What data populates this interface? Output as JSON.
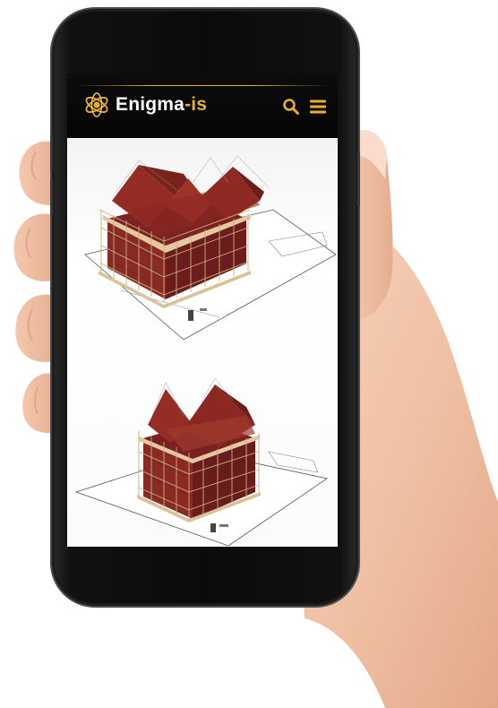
{
  "app": {
    "brand_prefix": "Enigma",
    "brand_suffix": "-is"
  },
  "header": {
    "search_icon": "search-icon",
    "menu_icon": "hamburger-menu-icon"
  },
  "content": {
    "images": [
      {
        "subject": "scaffolded-building-render-top"
      },
      {
        "subject": "scaffolded-building-render-bottom"
      }
    ]
  },
  "colors": {
    "accent": "#e8b028",
    "header_bg": "#0a0a0a",
    "roof": "#8f2a22",
    "brick": "#7a2020",
    "scaffold": "#c8b27a"
  }
}
